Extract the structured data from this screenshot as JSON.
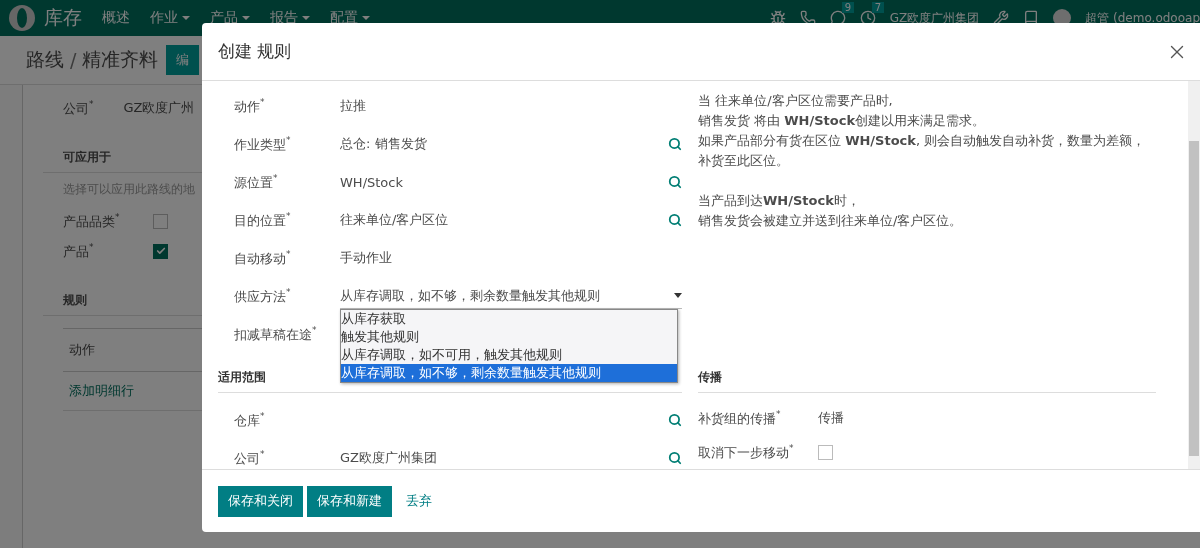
{
  "navbar": {
    "app": "库存",
    "menus": [
      {
        "label": "概述",
        "dropdown": false
      },
      {
        "label": "作业",
        "dropdown": true
      },
      {
        "label": "产品",
        "dropdown": true
      },
      {
        "label": "报告",
        "dropdown": true
      },
      {
        "label": "配置",
        "dropdown": true
      }
    ],
    "messages_badge": "9",
    "activities_badge": "7",
    "company": "GZ欧度广州集团",
    "user": "超管 (demo.odooap"
  },
  "breadcrumb": {
    "parent": "路线",
    "separator": "/",
    "current": "精准齐料",
    "edit_button": "编"
  },
  "form": {
    "company_label": "公司$^{*}$",
    "company_value": "GZ欧度广州",
    "applicable_title": "可应用于",
    "applicable_hint": "选择可以应用此路线的地",
    "options": [
      {
        "label": "产品品类$^{*}$",
        "checked": false
      },
      {
        "label": "产品$^{*}$",
        "checked": true
      }
    ],
    "rules_title": "规则",
    "rules_column": "动作",
    "add_line": "添加明细行"
  },
  "dialog": {
    "title": "创建 规则",
    "fields": [
      {
        "kind": "text",
        "label": "动作$^{*}$",
        "value": "拉推"
      },
      {
        "kind": "lookup",
        "label": "作业类型$^{*}$",
        "value": "总仓: 销售发货"
      },
      {
        "kind": "lookup",
        "label": "源位置$^{*}$",
        "value": "WH/Stock"
      },
      {
        "kind": "lookup",
        "label": "目的位置$^{*}$",
        "value": "往来单位/客户区位"
      },
      {
        "kind": "text",
        "label": "自动移动$^{*}$",
        "value": "手动作业"
      },
      {
        "kind": "select",
        "label": "供应方法$^{*}$",
        "value": "从库存调取，如不够，剩余数量触发其他规则",
        "options": [
          {
            "label": "从库存获取",
            "selected": false
          },
          {
            "label": "触发其他规则",
            "selected": false
          },
          {
            "label": "从库存调取，如不可用，触发其他规则",
            "selected": false
          },
          {
            "label": "从库存调取，如不够，剩余数量触发其他规则",
            "selected": true
          }
        ]
      },
      {
        "kind": "label",
        "label": "扣减草稿在途$^{*}$"
      }
    ],
    "help": [
      [
        "当 往来单位/客户区位需要产品时,",
        "销售发货 将由 **WH/Stock**创建以用来满足需求。",
        "如果产品部分有货在区位 **WH/Stock**, 则会自动触发自动补货，数量为差额，补货至此区位。"
      ],
      [
        "当产品到达**WH/Stock**时，",
        "销售发货会被建立并送到往来单位/客户区位。"
      ]
    ],
    "scope": {
      "title": "适用范围",
      "fields": [
        {
          "kind": "lookup",
          "label": "仓库$^{*}$"
        },
        {
          "kind": "lookup",
          "label": "公司$^{*}$",
          "value": "GZ欧度广州集团"
        }
      ]
    },
    "propagation": {
      "title": "传播",
      "fields": [
        {
          "kind": "text",
          "label": "补货组的传播$^{*}$",
          "value": "传播"
        },
        {
          "kind": "checkbox",
          "label": "取消下一步移动$^{*}$",
          "checked": false
        }
      ]
    },
    "buttons": [
      {
        "kind": "primary",
        "label": "保存和关闭"
      },
      {
        "kind": "primary",
        "label": "保存和新建"
      },
      {
        "kind": "link",
        "label": "丢弃"
      }
    ]
  }
}
